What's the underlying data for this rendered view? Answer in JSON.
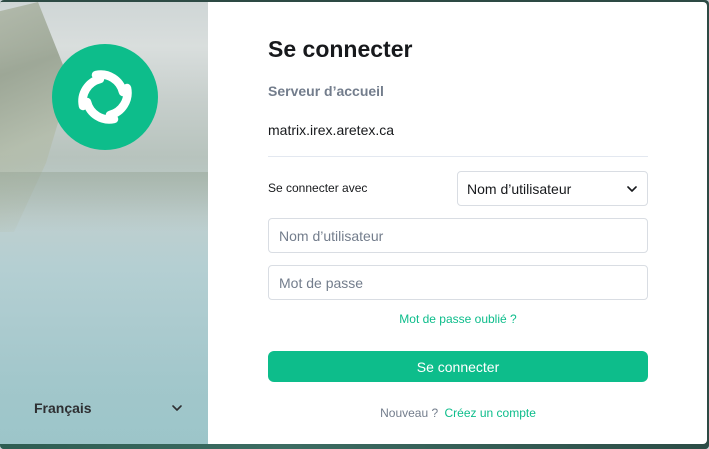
{
  "page": {
    "title": "Se connecter",
    "homeserver_label": "Serveur d’accueil",
    "homeserver_value": "matrix.irex.aretex.ca"
  },
  "login": {
    "with_label": "Se connecter avec",
    "method_selected": "Nom d’utilisateur",
    "username_placeholder": "Nom d’utilisateur",
    "password_placeholder": "Mot de passe",
    "forgot_password": "Mot de passe oublié ?",
    "submit_label": "Se connecter"
  },
  "footer": {
    "question": "Nouveau ?",
    "create_account": "Créez un compte"
  },
  "language": {
    "selected": "Français"
  },
  "icons": {
    "logo": "element-logo-icon",
    "language_dropdown": "chevron-down-icon",
    "method_dropdown": "chevron-down-icon"
  },
  "colors": {
    "accent": "#0dbd8b",
    "text": "#17191c",
    "muted": "#737d8c",
    "border": "#d9dde3"
  }
}
